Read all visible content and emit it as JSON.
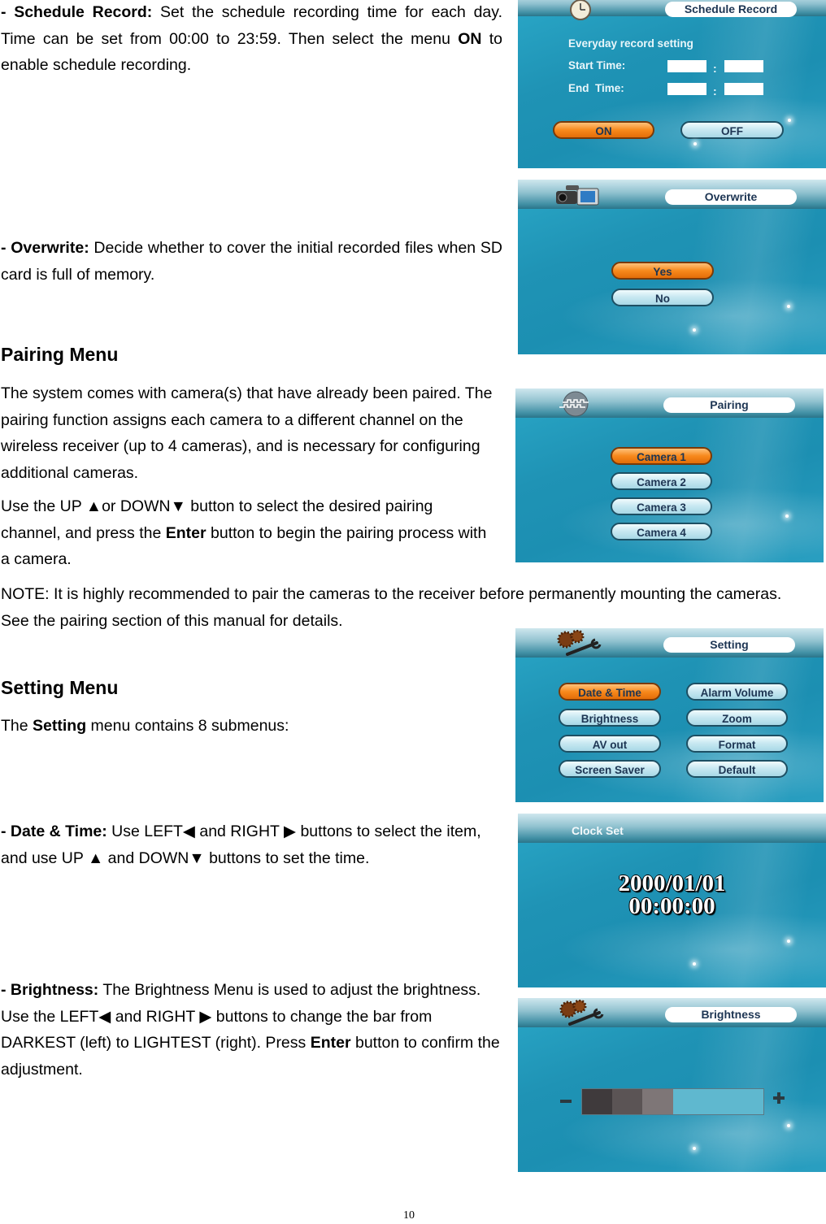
{
  "sections": {
    "schedule_record": {
      "label": "- Schedule Record:",
      "text_1": " Set the schedule recording time for each day. Time can be set from 00:00 to 23:59. Then select the menu ",
      "on_word": "ON",
      "text_2": " to enable schedule recording."
    },
    "overwrite": {
      "label": "- Overwrite:",
      "text": " Decide whether to cover the initial recorded files when SD card is full of memory."
    },
    "pairing": {
      "heading": "Pairing Menu",
      "para_1": "The system comes with camera(s) that have already been paired. The pairing function assigns each camera to a different channel on the wireless receiver (up to 4 cameras), and is necessary for configuring additional cameras.",
      "para_2a": "Use the UP ▲or DOWN▼ button to select the desired pairing channel, and press the ",
      "para_2_bold": "Enter",
      "para_2b": " button to begin the pairing process with a camera.",
      "note": "NOTE: It is highly recommended to pair the cameras to the receiver before permanently mounting the cameras. See the pairing section of this manual for details."
    },
    "setting": {
      "heading": "Setting Menu",
      "intro_a": "The ",
      "intro_bold": "Setting",
      "intro_b": " menu contains 8 submenus:"
    },
    "date_time": {
      "label": "- Date & Time:",
      "text": " Use LEFT◀ and RIGHT ▶ buttons to select the item, and use UP ▲ and DOWN▼ buttons to set the time."
    },
    "brightness": {
      "label": "- Brightness:",
      "text_1": " The Brightness Menu is used to adjust the brightness. Use the LEFT◀ and RIGHT ▶ buttons to change the bar from DARKEST (left) to LIGHTEST (right). Press ",
      "enter_word": "Enter",
      "text_2": " button to confirm the adjustment."
    }
  },
  "screens": {
    "schedule_record": {
      "title": "Schedule Record",
      "icon": "clock-icon",
      "subtitle": "Everyday record setting",
      "start_label": "Start Time:",
      "end_label": "End  Time:",
      "colon": ":",
      "start_hour": "",
      "start_minute": "",
      "end_hour": "",
      "end_minute": "",
      "on_label": "ON",
      "off_label": "OFF",
      "selected": "ON"
    },
    "overwrite": {
      "title": "Overwrite",
      "icon": "camcorder-icon",
      "yes_label": "Yes",
      "no_label": "No",
      "selected": "Yes"
    },
    "pairing": {
      "title": "Pairing",
      "icon": "pairing-signal-icon",
      "items": [
        "Camera 1",
        "Camera 2",
        "Camera 3",
        "Camera 4"
      ],
      "selected": "Camera 1"
    },
    "setting": {
      "title": "Setting",
      "icon": "gears-wrench-icon",
      "items": [
        "Date & Time",
        "Alarm Volume",
        "Brightness",
        "Zoom",
        "AV out",
        "Format",
        "Screen Saver",
        "Default"
      ],
      "selected": "Date & Time"
    },
    "clock_set": {
      "title": "Clock Set",
      "date": "2000/01/01",
      "time": "00:00:00"
    },
    "brightness": {
      "title": "Brightness",
      "icon": "gears-wrench-icon",
      "minus_icon": "minus-icon",
      "plus_icon": "plus-icon",
      "level": 3,
      "max_level": 6,
      "segment_colors": [
        "#3f3a3c",
        "#5b5455",
        "#7e7677"
      ],
      "empty_color": "#5fb8cf"
    }
  },
  "colors": {
    "selected_button": "#f7891c",
    "unselected_button": "#c9e9f2",
    "screen_bg": "#1f93b5",
    "button_text": "#1d3553"
  },
  "footer": {
    "page_number": "10"
  }
}
